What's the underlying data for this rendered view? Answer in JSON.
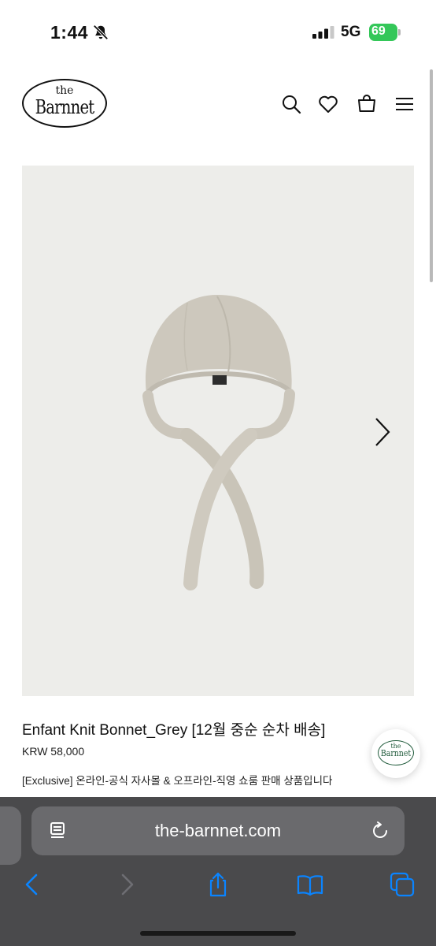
{
  "status_bar": {
    "time": "1:44",
    "network": "5G",
    "battery": "69"
  },
  "header": {
    "logo_the": "the",
    "logo_name": "Barnnet"
  },
  "product": {
    "title": "Enfant Knit Bonnet_Grey [12월 중순 순차 배송]",
    "price": "KRW 58,000",
    "note": "[Exclusive] 온라인-공식 자사몰 & 오프라인-직영 쇼룸 판매 상품입니다",
    "image_background": "#ededea",
    "knit_color": "#cbc6bb"
  },
  "floating_badge": {
    "the": "the",
    "name": "Barnnet"
  },
  "browser": {
    "url": "the-barnnet.com",
    "accent": "#0a84ff",
    "chrome_color": "#4a4a4c"
  }
}
